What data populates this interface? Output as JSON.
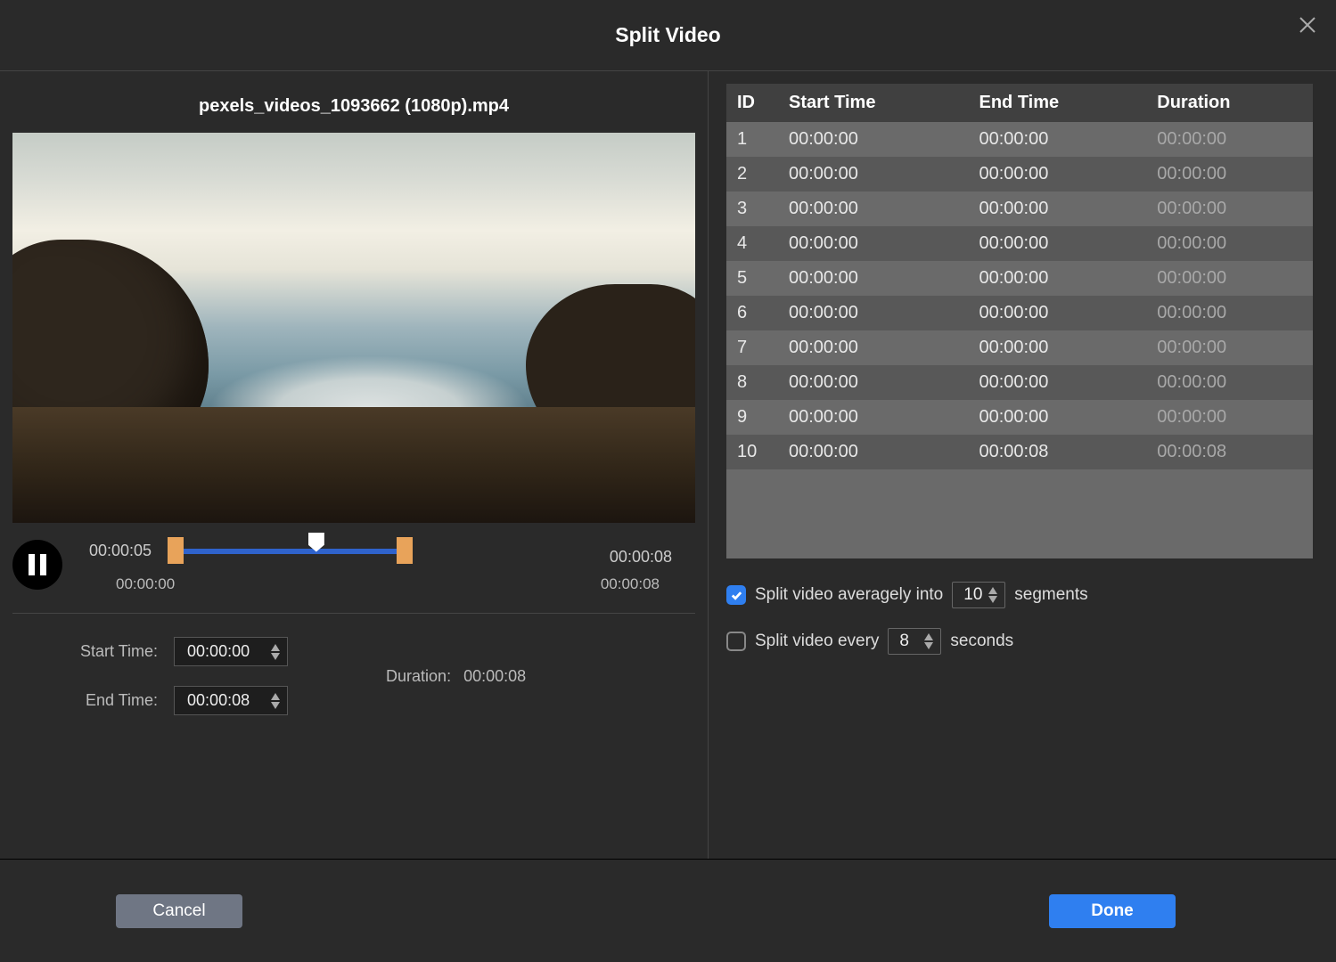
{
  "title": "Split Video",
  "filename": "pexels_videos_1093662 (1080p).mp4",
  "timeline": {
    "current": "00:00:05",
    "total": "00:00:08",
    "range_start": "00:00:00",
    "range_end": "00:00:08"
  },
  "start_label": "Start Time:",
  "end_label": "End Time:",
  "start_value": "00:00:00",
  "end_value": "00:00:08",
  "duration_label": "Duration:",
  "duration_value": "00:00:08",
  "table": {
    "headers": {
      "id": "ID",
      "start": "Start Time",
      "end": "End Time",
      "dur": "Duration"
    },
    "rows": [
      {
        "id": "1",
        "start": "00:00:00",
        "end": "00:00:00",
        "dur": "00:00:00"
      },
      {
        "id": "2",
        "start": "00:00:00",
        "end": "00:00:00",
        "dur": "00:00:00"
      },
      {
        "id": "3",
        "start": "00:00:00",
        "end": "00:00:00",
        "dur": "00:00:00"
      },
      {
        "id": "4",
        "start": "00:00:00",
        "end": "00:00:00",
        "dur": "00:00:00"
      },
      {
        "id": "5",
        "start": "00:00:00",
        "end": "00:00:00",
        "dur": "00:00:00"
      },
      {
        "id": "6",
        "start": "00:00:00",
        "end": "00:00:00",
        "dur": "00:00:00"
      },
      {
        "id": "7",
        "start": "00:00:00",
        "end": "00:00:00",
        "dur": "00:00:00"
      },
      {
        "id": "8",
        "start": "00:00:00",
        "end": "00:00:00",
        "dur": "00:00:00"
      },
      {
        "id": "9",
        "start": "00:00:00",
        "end": "00:00:00",
        "dur": "00:00:00"
      },
      {
        "id": "10",
        "start": "00:00:00",
        "end": "00:00:08",
        "dur": "00:00:08"
      }
    ]
  },
  "opt1": {
    "label_pre": "Split video averagely into",
    "value": "10",
    "label_post": "segments",
    "checked": true
  },
  "opt2": {
    "label_pre": "Split video every",
    "value": "8",
    "label_post": "seconds",
    "checked": false
  },
  "buttons": {
    "cancel": "Cancel",
    "done": "Done"
  }
}
